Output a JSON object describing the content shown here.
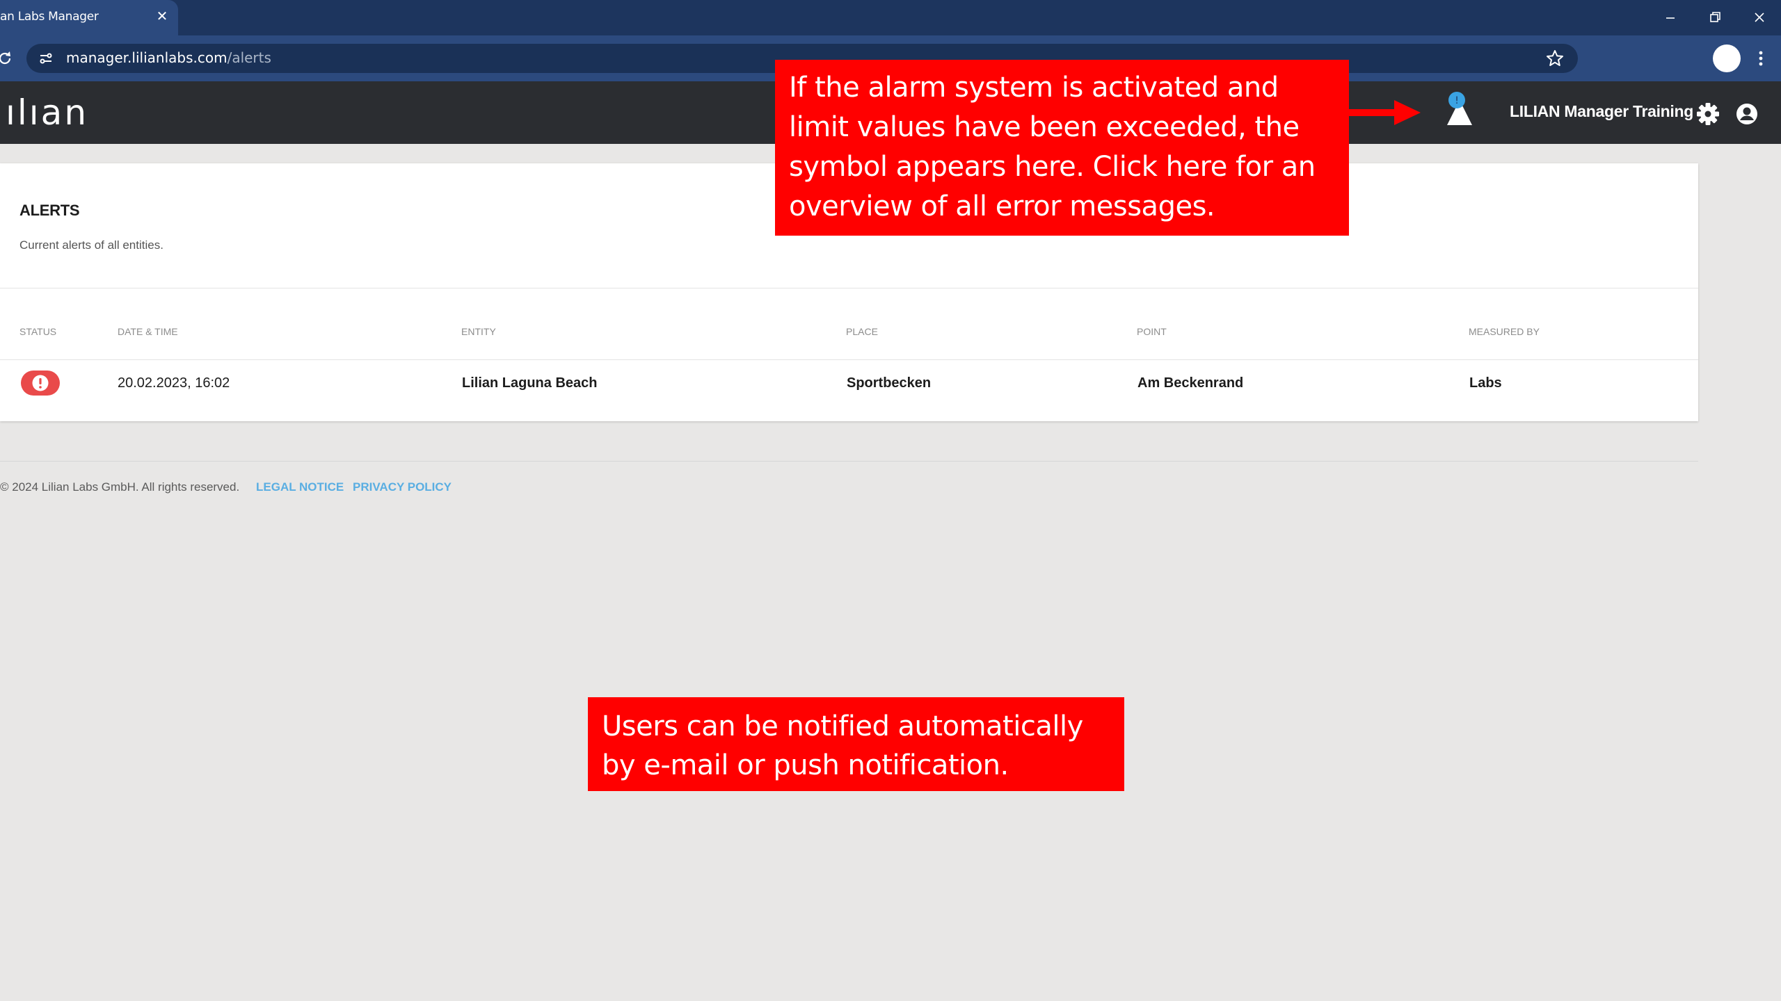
{
  "browser": {
    "tab_title": "an Labs Manager",
    "url_host": "manager.lilianlabs.com",
    "url_path": "/alerts"
  },
  "app": {
    "logo": "ılıan",
    "account_name": "LILIAN Manager Training",
    "notification_count": "!"
  },
  "alerts_card": {
    "title": "ALERTS",
    "subtitle": "Current alerts of all entities.",
    "columns": [
      "STATUS",
      "DATE & TIME",
      "ENTITY",
      "PLACE",
      "POINT",
      "MEASURED BY"
    ],
    "rows": [
      {
        "status": "error",
        "datetime": "20.02.2023, 16:02",
        "entity": "Lilian Laguna Beach",
        "place": "Sportbecken",
        "point": "Am Beckenrand",
        "measured_by": "Labs"
      }
    ]
  },
  "footer": {
    "copyright": "© 2024 Lilian Labs GmbH. All rights reserved.",
    "legal_notice": "LEGAL NOTICE",
    "privacy_policy": "PRIVACY POLICY"
  },
  "callouts": {
    "alarm_symbol": "If the alarm system is activated and limit values have been exceeded, the symbol appears here. Click here for an overview of all error messages.",
    "notifications": "Users can be notified automatically by e-mail or push notification."
  },
  "colors": {
    "callout": "#ff0000",
    "header_bg": "#2b2d31",
    "status_error": "#e94a4a",
    "link": "#5aaee2",
    "notification_badge": "#3aa3e3"
  }
}
